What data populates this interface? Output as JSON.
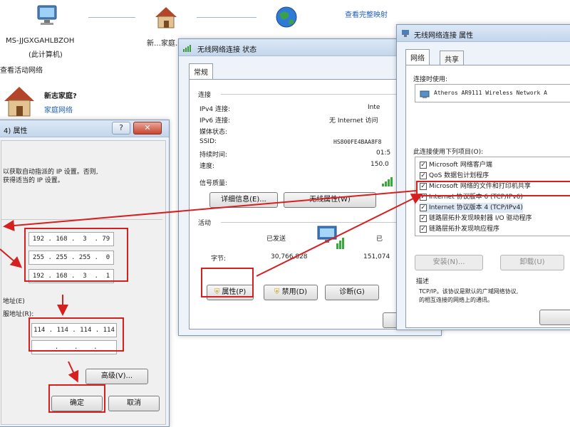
{
  "network_map": {
    "computer_name": "MS-JJGXGAHLBZOH",
    "computer_sub": "(此计算机)",
    "home_label": "新…家庭…",
    "internet_label": "Internet",
    "view_full_map": "查看完整映射",
    "active_networks": "查看活动网络",
    "network_name": "新志家庭?",
    "network_type": "家庭网络"
  },
  "ipv4_dialog": {
    "title": "4) 属性",
    "desc_line1": "以获取自动指派的 IP 设置。否则,",
    "desc_line2": "获得适当的 IP 设置。",
    "ip_address": "192 . 168 .  3  . 79",
    "subnet_mask": "255 . 255 . 255 .  0",
    "gateway": "192 . 168 .  3  .  1",
    "dns_group_label": "地址(E)",
    "dns_preferred_label": "服地址(R):",
    "dns_preferred": "114 . 114 . 114 . 114",
    "dns_alternate": " .    .    .",
    "advanced_button": "高级(V)...",
    "ok_button": "确定",
    "cancel_button": "取消"
  },
  "status_dialog": {
    "title": "无线网络连接 状态",
    "tab_general": "常规",
    "section_connection": "连接",
    "rows": [
      {
        "label": "IPv4 连接:",
        "value": "Inte"
      },
      {
        "label": "IPv6 连接:",
        "value": "无 Internet 访问"
      },
      {
        "label": "媒体状态:",
        "value": ""
      },
      {
        "label": "SSID:",
        "value": "HS800FE4BAA8F8"
      },
      {
        "label": "持续时间:",
        "value": "01:5"
      },
      {
        "label": "速度:",
        "value": "150.0"
      }
    ],
    "signal_quality": "信号质量:",
    "details_button": "详细信息(E)...",
    "wireless_props_button": "无线属性(W)",
    "section_activity": "活动",
    "sent_label": "已发送",
    "received_label": "已",
    "bytes_label": "字节:",
    "bytes_sent": "30,766,828",
    "bytes_received": "151,074",
    "properties_button": "属性(P)",
    "disable_button": "禁用(D)",
    "diagnose_button": "诊断(G)"
  },
  "props_dialog": {
    "title": "无线网络连接 属性",
    "tab_network": "网络",
    "tab_sharing": "共享",
    "connect_using_label": "连接时使用:",
    "adapter": "Atheros AR9111 Wireless Network A",
    "items_label": "此连接使用下列项目(O):",
    "items": [
      {
        "checked": true,
        "text": "Microsoft 网络客户端"
      },
      {
        "checked": true,
        "text": "QoS 数据包计划程序"
      },
      {
        "checked": true,
        "text": "Microsoft 网络的文件和打印机共享"
      },
      {
        "checked": true,
        "text": "Internet 协议版本 6 (TCP/IPv6)"
      },
      {
        "checked": true,
        "text": "Internet 协议版本 4 (TCP/IPv4)"
      },
      {
        "checked": true,
        "text": "链路层拓扑发现映射器 I/O 驱动程序"
      },
      {
        "checked": true,
        "text": "链路层拓扑发现响应程序"
      }
    ],
    "install_button": "安装(N)...",
    "uninstall_button": "卸载(U)",
    "description_label": "描述",
    "description_line1": "TCP/IP。该协议是默认的广域网络协议,",
    "description_line2": "的相互连接的网络上的通讯。"
  },
  "colors": {
    "annotation_red": "#d62020",
    "link_blue": "#1f5fb0",
    "title_bar": "#c4d6ec"
  }
}
